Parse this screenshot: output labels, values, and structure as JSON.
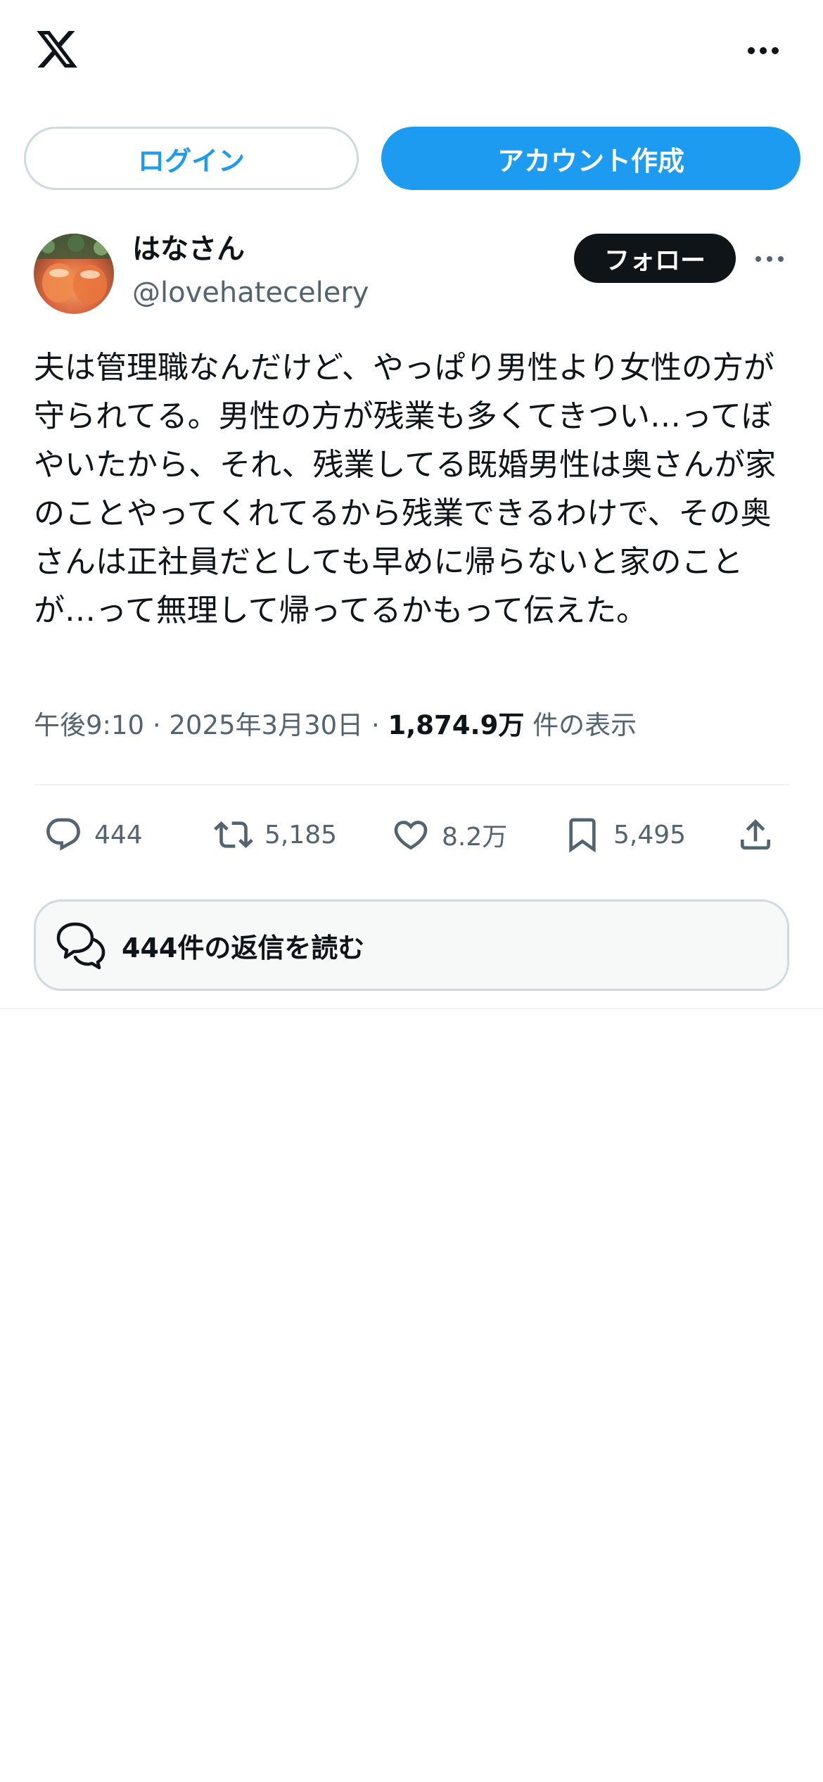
{
  "header": {
    "logo_icon": "x-logo-icon",
    "more_icon": "more-horizontal-icon"
  },
  "auth": {
    "login_label": "ログイン",
    "signup_label": "アカウント作成"
  },
  "author": {
    "display_name": "はなさん",
    "handle": "@lovehatecelery",
    "follow_label": "フォロー",
    "avatar_icon": "avatar-photo"
  },
  "post": {
    "text": "夫は管理職なんだけど、やっぱり男性より女性の方が守られてる。男性の方が残業も多くてきつい…ってぼやいたから、それ、残業してる既婚男性は奥さんが家のことやってくれてるから残業できるわけで、その奥さんは正社員だとしても早めに帰らないと家のことが…って無理して帰ってるかもって伝えた。",
    "time": "午後9:10",
    "separator": "·",
    "date": "2025年3月30日",
    "views_count": "1,874.9万",
    "views_label": "件の表示"
  },
  "actions": {
    "reply_count": "444",
    "retweet_count": "5,185",
    "like_count": "8.2万",
    "bookmark_count": "5,495"
  },
  "replies_button": {
    "label": "444件の返信を読む"
  },
  "colors": {
    "accent": "#1d9bf0",
    "text_primary": "#0f1419",
    "text_secondary": "#536471",
    "border": "#cfd9de"
  }
}
